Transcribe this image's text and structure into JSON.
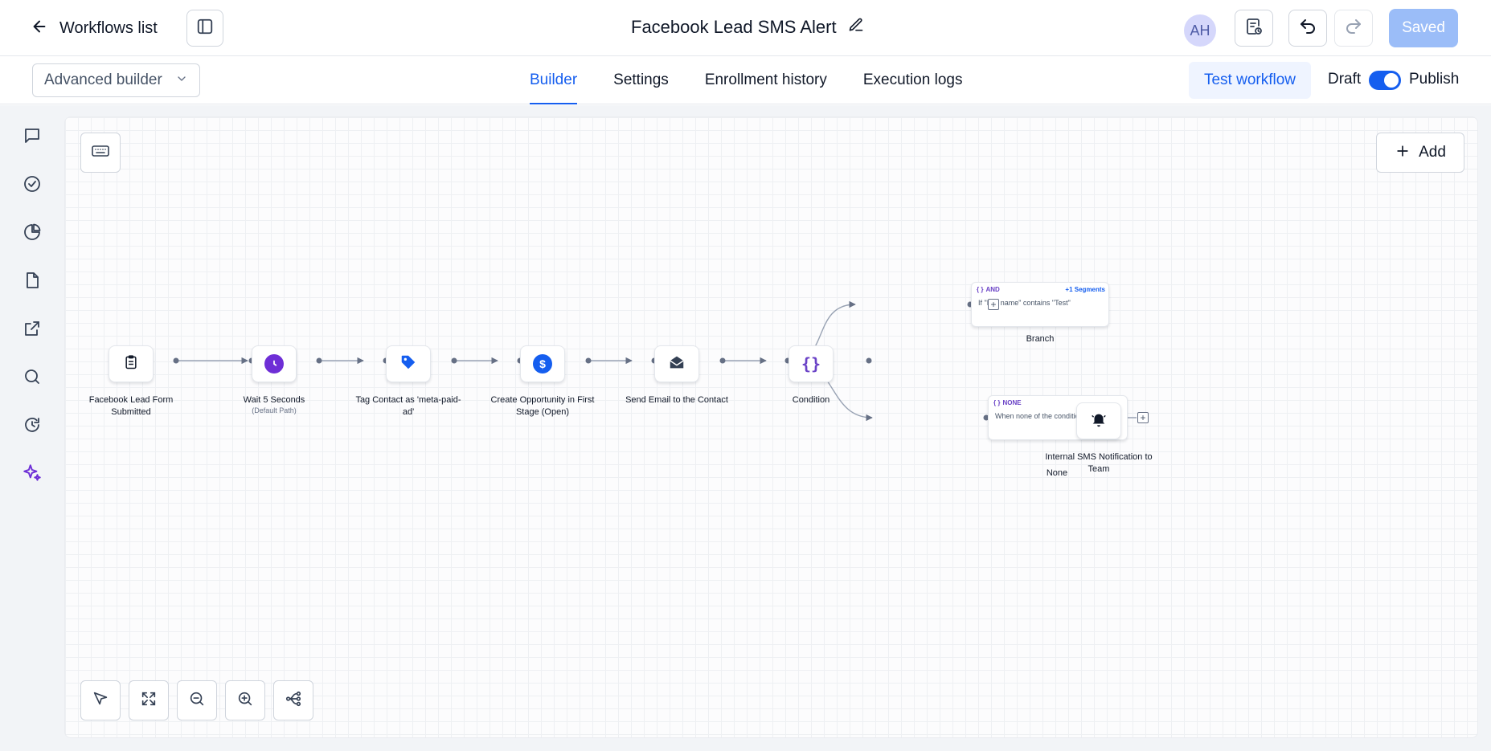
{
  "header": {
    "back_label": "Workflows list",
    "title": "Facebook Lead SMS Alert",
    "avatar_initials": "AH",
    "saved_label": "Saved"
  },
  "subbar": {
    "builder_mode": "Advanced builder",
    "tabs": [
      {
        "label": "Builder",
        "active": true
      },
      {
        "label": "Settings",
        "active": false
      },
      {
        "label": "Enrollment history",
        "active": false
      },
      {
        "label": "Execution logs",
        "active": false
      }
    ],
    "test_label": "Test workflow",
    "draft_label": "Draft",
    "publish_label": "Publish",
    "publish_toggle_on": true
  },
  "sidebar": {
    "items": [
      {
        "icon": "chat-icon"
      },
      {
        "icon": "check-circle-icon"
      },
      {
        "icon": "pie-chart-icon"
      },
      {
        "icon": "file-icon"
      },
      {
        "icon": "external-link-icon"
      },
      {
        "icon": "search-icon"
      },
      {
        "icon": "history-icon"
      },
      {
        "icon": "sparkle-icon",
        "active": true
      }
    ]
  },
  "canvas": {
    "add_label": "Add",
    "nodes": [
      {
        "label": "Facebook Lead Form Submitted",
        "icon": "clipboard-icon"
      },
      {
        "label": "Wait 5 Seconds",
        "sublabel": "(Default Path)",
        "icon": "clock-icon"
      },
      {
        "label": "Tag Contact as 'meta-paid-ad'",
        "icon": "tag-icon"
      },
      {
        "label": "Create Opportunity in First Stage (Open)",
        "icon": "dollar-icon"
      },
      {
        "label": "Send Email to the Contact",
        "icon": "envelope-icon"
      },
      {
        "label": "Condition",
        "icon": "braces-icon"
      },
      {
        "label": "Internal SMS Notification to Team",
        "icon": "bell-icon"
      }
    ],
    "branches": [
      {
        "tag": "AND",
        "segments": "+1 Segments",
        "condition": "If \"Full name\" contains \"Test\"",
        "label": "Branch"
      },
      {
        "tag": "NONE",
        "condition": "When none of the conditions are met",
        "label": "None"
      }
    ]
  },
  "colors": {
    "accent": "#155eef",
    "saved_button": "#9bbdf8",
    "wait_icon": "#6e2ed6",
    "tag_icon": "#155eef",
    "dollar_icon": "#155eef",
    "condition_icon": "#6941c6"
  }
}
